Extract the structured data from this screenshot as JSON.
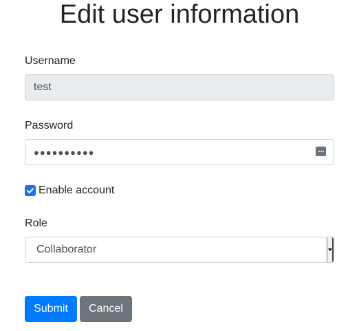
{
  "page": {
    "title": "Edit user information"
  },
  "form": {
    "username": {
      "label": "Username",
      "value": "test"
    },
    "password": {
      "label": "Password",
      "masked_value": "●●●●●●●●●●",
      "icon": "password-reveal-icon"
    },
    "enable_account": {
      "label": "Enable account",
      "checked": true,
      "icon": "checkmark-icon"
    },
    "role": {
      "label": "Role",
      "selected": "Collaborator",
      "icon": "chevron-down-icon"
    },
    "submit_label": "Submit",
    "cancel_label": "Cancel"
  },
  "colors": {
    "primary": "#007bff",
    "secondary": "#6c757d",
    "readonly_bg": "#e9ecef",
    "checkbox": "#1a73e8"
  }
}
